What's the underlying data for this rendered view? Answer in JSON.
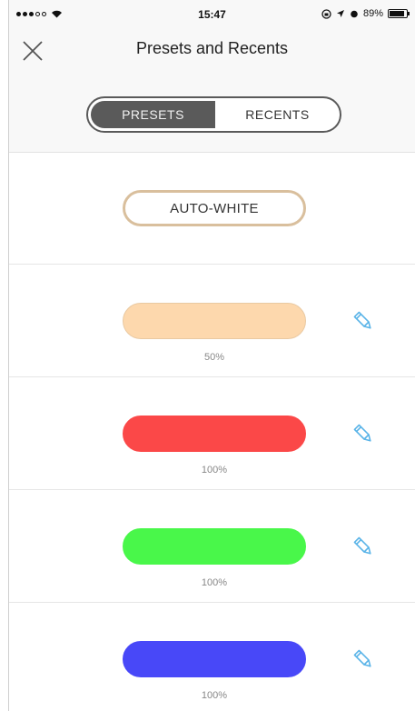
{
  "status_bar": {
    "carrier_signal": "●●●○○",
    "time": "15:47",
    "battery_text": "89%",
    "battery_level": 0.89
  },
  "header": {
    "title": "Presets and Recents",
    "close_icon": "close-icon"
  },
  "tabs": [
    {
      "label": "PRESETS",
      "active": true
    },
    {
      "label": "RECENTS",
      "active": false
    }
  ],
  "presets": {
    "auto_white_label": "AUTO-WHITE",
    "items": [
      {
        "color": "#fdd8ad",
        "border": "#e9c9a2",
        "percent": "50%"
      },
      {
        "color": "#fb4848",
        "border": "#fb4848",
        "percent": "100%"
      },
      {
        "color": "#49f74a",
        "border": "#49f74a",
        "percent": "100%"
      },
      {
        "color": "#4848f8",
        "border": "#4848f8",
        "percent": "100%"
      }
    ],
    "edit_icon": "pencil-icon",
    "edit_icon_color": "#5ab4e8"
  }
}
